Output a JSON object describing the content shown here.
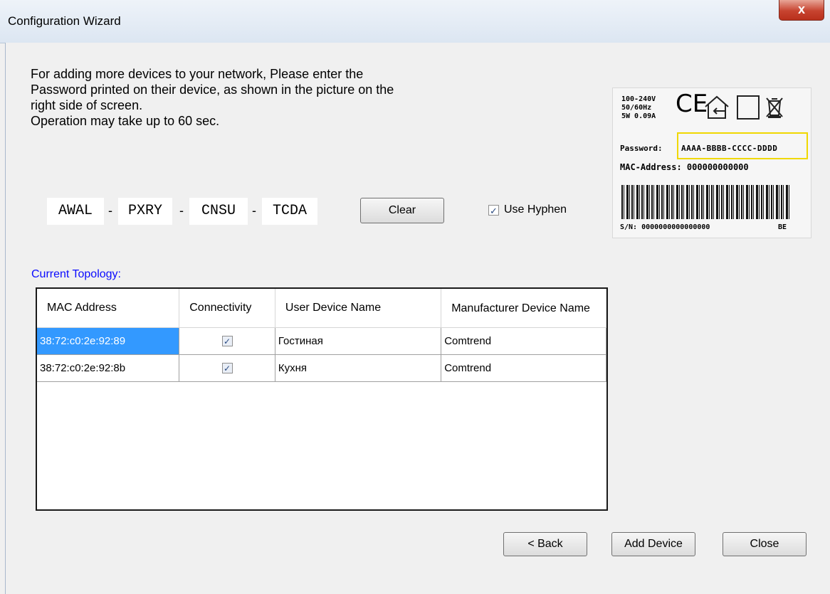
{
  "window": {
    "title": "Configuration Wizard",
    "close_glyph": "x"
  },
  "instructions": {
    "lines": [
      "For adding more devices to your network, Please enter the",
      "Password printed on their device, as shown in the picture on the",
      "right side of screen.",
      "Operation may take up to 60 sec."
    ]
  },
  "password": {
    "segments": [
      "AWAL",
      "PXRY",
      "CNSU",
      "TCDA"
    ],
    "separator": "-"
  },
  "buttons": {
    "clear": "Clear",
    "back": "< Back",
    "add_device": "Add Device",
    "close": "Close"
  },
  "use_hyphen": {
    "label": "Use Hyphen",
    "checked": true
  },
  "device_label": {
    "specs": [
      "100-240V",
      "50/60Hz",
      "5W 0.09A"
    ],
    "ce_mark": "CE",
    "password_label": "Password:",
    "password_example": "AAAA-BBBB-CCCC-DDDD",
    "mac_label": "MAC-Address: 000000000000",
    "sn_label": "S/N: 0000000000000000",
    "sn_suffix": "BE"
  },
  "topology": {
    "label": "Current Topology:",
    "columns": [
      "MAC Address",
      "Connectivity",
      "User Device Name",
      "Manufacturer Device Name"
    ],
    "rows": [
      {
        "mac": "38:72:c0:2e:92:89",
        "connected": true,
        "user_name": "Гостиная",
        "manufacturer": "Comtrend",
        "selected": true
      },
      {
        "mac": "38:72:c0:2e:92:8b",
        "connected": true,
        "user_name": "Кухня",
        "manufacturer": "Comtrend",
        "selected": false
      }
    ]
  },
  "icons": {
    "check": "✓"
  }
}
